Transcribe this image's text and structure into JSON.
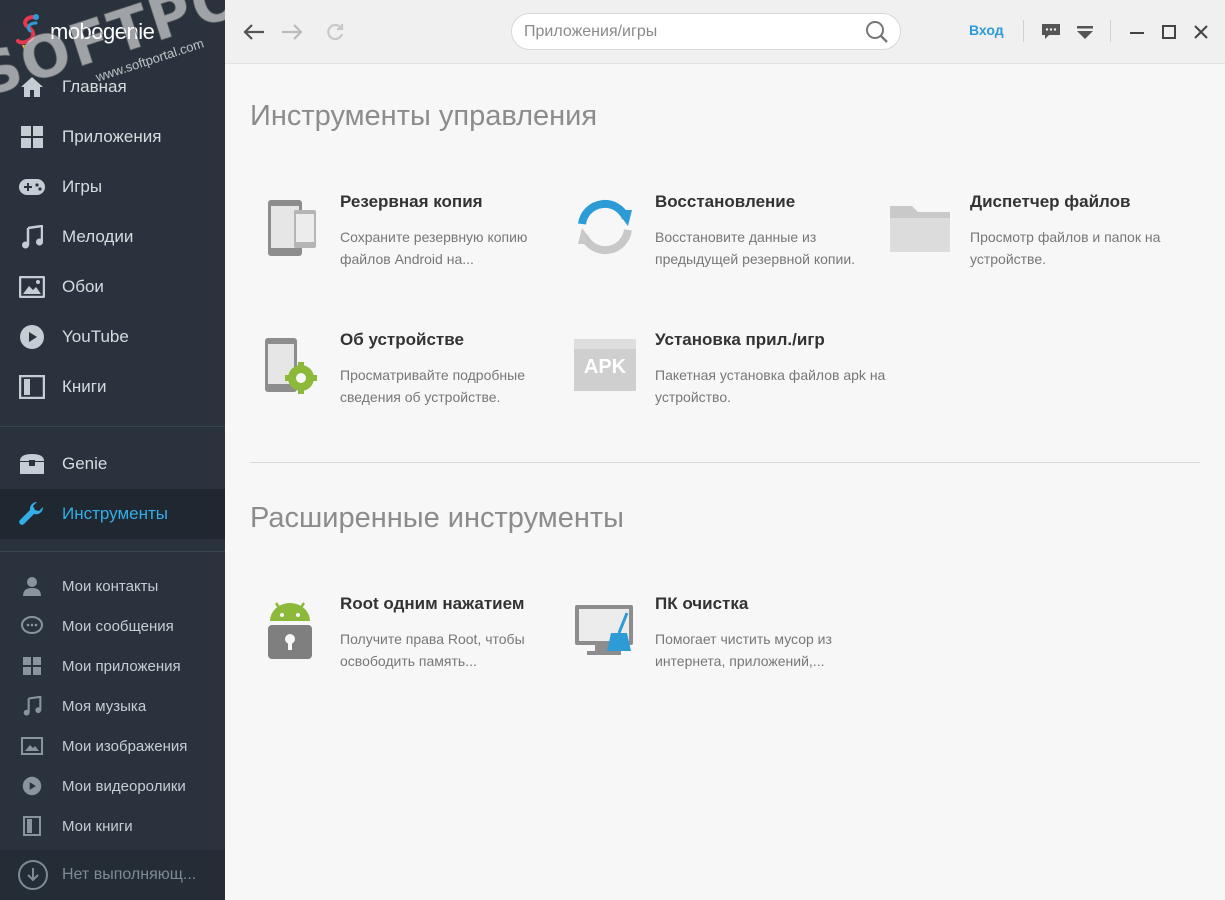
{
  "app": {
    "logo_text": "mobogenie",
    "watermark_main": "SOFTPORTAL",
    "watermark_sub": "www.softportal.com"
  },
  "sidebar": {
    "main_items": [
      {
        "label": "Главная",
        "icon": "home-icon"
      },
      {
        "label": "Приложения",
        "icon": "apps-grid-icon"
      },
      {
        "label": "Игры",
        "icon": "gamepad-icon"
      },
      {
        "label": "Мелодии",
        "icon": "music-note-icon"
      },
      {
        "label": "Обои",
        "icon": "wallpaper-icon"
      },
      {
        "label": "YouTube",
        "icon": "play-icon"
      },
      {
        "label": "Книги",
        "icon": "book-icon"
      }
    ],
    "genie": {
      "label": "Genie",
      "icon": "chest-icon"
    },
    "tools": {
      "label": "Инструменты",
      "icon": "wrench-icon",
      "active": true
    },
    "sub_items": [
      {
        "label": "Мои контакты",
        "icon": "contact-icon"
      },
      {
        "label": "Мои сообщения",
        "icon": "message-icon"
      },
      {
        "label": "Мои приложения",
        "icon": "apps-grid-icon"
      },
      {
        "label": "Моя музыка",
        "icon": "music-note-icon"
      },
      {
        "label": "Мои изображения",
        "icon": "image-icon"
      },
      {
        "label": "Мои видеоролики",
        "icon": "play-icon"
      },
      {
        "label": "Мои книги",
        "icon": "book-icon"
      }
    ],
    "footer": {
      "label": "Нет выполняющ...",
      "icon": "download-icon"
    }
  },
  "topbar": {
    "search_placeholder": "Приложения/игры",
    "login_label": "Вход"
  },
  "content": {
    "section1_title": "Инструменты управления",
    "section2_title": "Расширенные инструменты",
    "tools": [
      {
        "name": "Резервная копия",
        "desc": "Сохраните резервную копию файлов Android на..."
      },
      {
        "name": "Восстановление",
        "desc": "Восстановите данные из предыдущей резервной копии."
      },
      {
        "name": "Диспетчер файлов",
        "desc": "Просмотр файлов и папок на устройстве."
      },
      {
        "name": "Об устройстве",
        "desc": "Просматривайте подробные сведения об устройстве."
      },
      {
        "name": "Установка прил./игр",
        "desc": "Пакетная установка файлов apk на устройство.",
        "icon_label": "APK"
      }
    ],
    "advanced_tools": [
      {
        "name": "Root одним нажатием",
        "desc": "Получите права Root, чтобы освободить память..."
      },
      {
        "name": "ПК очистка",
        "desc": "Помогает чистить мусор из интернета, приложений,..."
      }
    ]
  },
  "colors": {
    "sidebar_bg": "#2a333d",
    "accent": "#33aee6",
    "login": "#2d9bd6",
    "android_green": "#8cb93a",
    "restore_blue": "#2d9bd6"
  }
}
